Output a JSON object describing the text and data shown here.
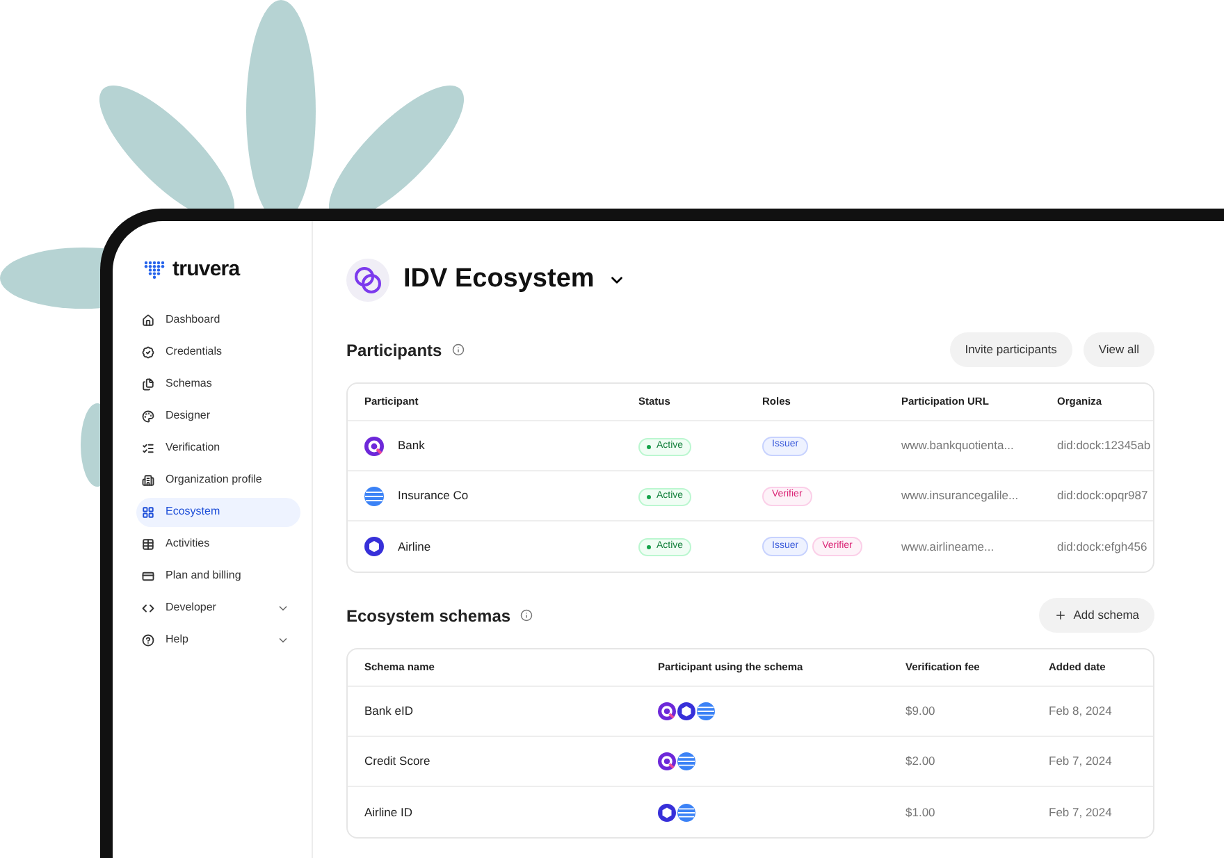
{
  "brand": "truvera",
  "sidebar": {
    "items": [
      {
        "label": "Dashboard",
        "kind": "home",
        "selected": false
      },
      {
        "label": "Credentials",
        "kind": "badge",
        "selected": false
      },
      {
        "label": "Schemas",
        "kind": "files",
        "selected": false
      },
      {
        "label": "Designer",
        "kind": "palette",
        "selected": false
      },
      {
        "label": "Verification",
        "kind": "checklist",
        "selected": false
      },
      {
        "label": "Organization profile",
        "kind": "building",
        "selected": false
      },
      {
        "label": "Ecosystem",
        "kind": "grid",
        "selected": true
      },
      {
        "label": "Activities",
        "kind": "table",
        "selected": false
      },
      {
        "label": "Plan and billing",
        "kind": "card",
        "selected": false
      },
      {
        "label": "Developer",
        "kind": "code",
        "selected": false,
        "expandable": true
      },
      {
        "label": "Help",
        "kind": "help",
        "selected": false,
        "expandable": true
      }
    ]
  },
  "ecosystem": {
    "title": "IDV Ecosystem"
  },
  "participants": {
    "title": "Participants",
    "buttons": [
      "Invite participants",
      "View all"
    ],
    "columns": [
      "Participant",
      "Status",
      "Roles",
      "Participation URL",
      "Organiza"
    ],
    "rows": [
      {
        "name": "Bank",
        "kind": "q",
        "status": "Active",
        "roles": [
          {
            "label": "Issuer",
            "kind": "issuer"
          }
        ],
        "url": "www.bankquotienta...",
        "org": "did:dock:12345ab"
      },
      {
        "name": "Insurance Co",
        "kind": "globe",
        "status": "Active",
        "roles": [
          {
            "label": "Verifier",
            "kind": "verifier"
          }
        ],
        "url": "www.insurancegalile...",
        "org": "did:dock:opqr987"
      },
      {
        "name": "Airline",
        "kind": "hex",
        "status": "Active",
        "roles": [
          {
            "label": "Issuer",
            "kind": "issuer"
          },
          {
            "label": "Verifier",
            "kind": "verifier"
          }
        ],
        "url": "www.airlineame...",
        "org": "did:dock:efgh456"
      }
    ]
  },
  "schemas": {
    "title": "Ecosystem schemas",
    "add_button": "Add schema",
    "columns": [
      "Schema name",
      "Participant using the schema",
      "Verification fee",
      "Added date"
    ],
    "rows": [
      {
        "name": "Bank eID",
        "participants": [
          {
            "kind": "q"
          },
          {
            "kind": "hex"
          },
          {
            "kind": "globe"
          }
        ],
        "fee": "$9.00",
        "date": "Feb 8, 2024"
      },
      {
        "name": "Credit Score",
        "participants": [
          {
            "kind": "q"
          },
          {
            "kind": "globe"
          }
        ],
        "fee": "$2.00",
        "date": "Feb 7, 2024"
      },
      {
        "name": "Airline ID",
        "participants": [
          {
            "kind": "hex"
          },
          {
            "kind": "globe"
          }
        ],
        "fee": "$1.00",
        "date": "Feb 7, 2024"
      }
    ]
  }
}
